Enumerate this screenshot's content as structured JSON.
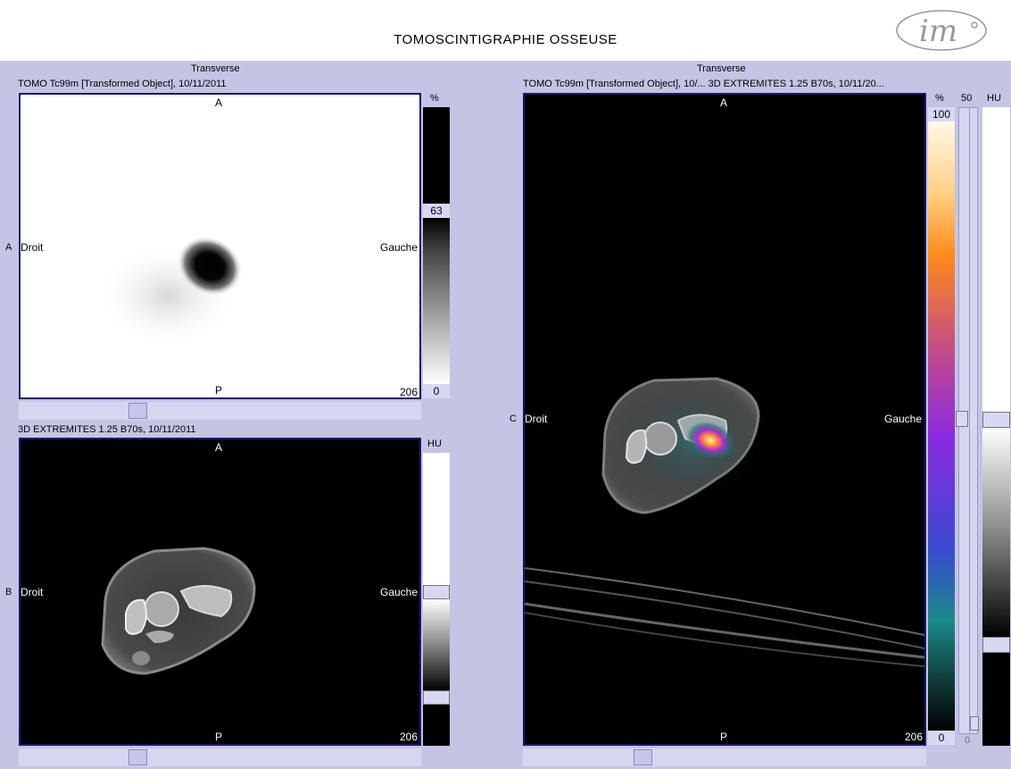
{
  "header": {
    "title": "TOMOSCINTIGRAPHIE OSSEUSE",
    "logo_text": "im"
  },
  "panel_a": {
    "section": "Transverse",
    "series": "TOMO Tc99m [Transformed Object], 10/11/2011",
    "row_letter": "A",
    "top": "A",
    "bottom": "P",
    "left": "Droit",
    "right": "Gauche",
    "slice": "206",
    "scale_unit": "%",
    "scale_max": "63",
    "scale_min": "0"
  },
  "panel_b": {
    "series": "3D EXTREMITES  1.25  B70s, 10/11/2011",
    "row_letter": "B",
    "top": "A",
    "bottom": "P",
    "left": "Droit",
    "right": "Gauche",
    "slice": "206",
    "scale_unit": "HU"
  },
  "panel_c": {
    "section": "Transverse",
    "series": "TOMO Tc99m [Transformed Object], 10/...  3D EXTREMITES  1.25  B70s, 10/11/20...",
    "row_letter": "C",
    "top": "A",
    "bottom": "P",
    "left": "Droit",
    "right": "Gauche",
    "slice": "206",
    "scale_unit": "%",
    "scale_max": "100",
    "scale_min": "0",
    "blend_label": "50",
    "blend_min": "0",
    "hu_unit": "HU"
  },
  "colors": {
    "background": "#c4c4e4",
    "viewport_border": "#1a1a6a",
    "value_box": "#d8d8f4"
  }
}
